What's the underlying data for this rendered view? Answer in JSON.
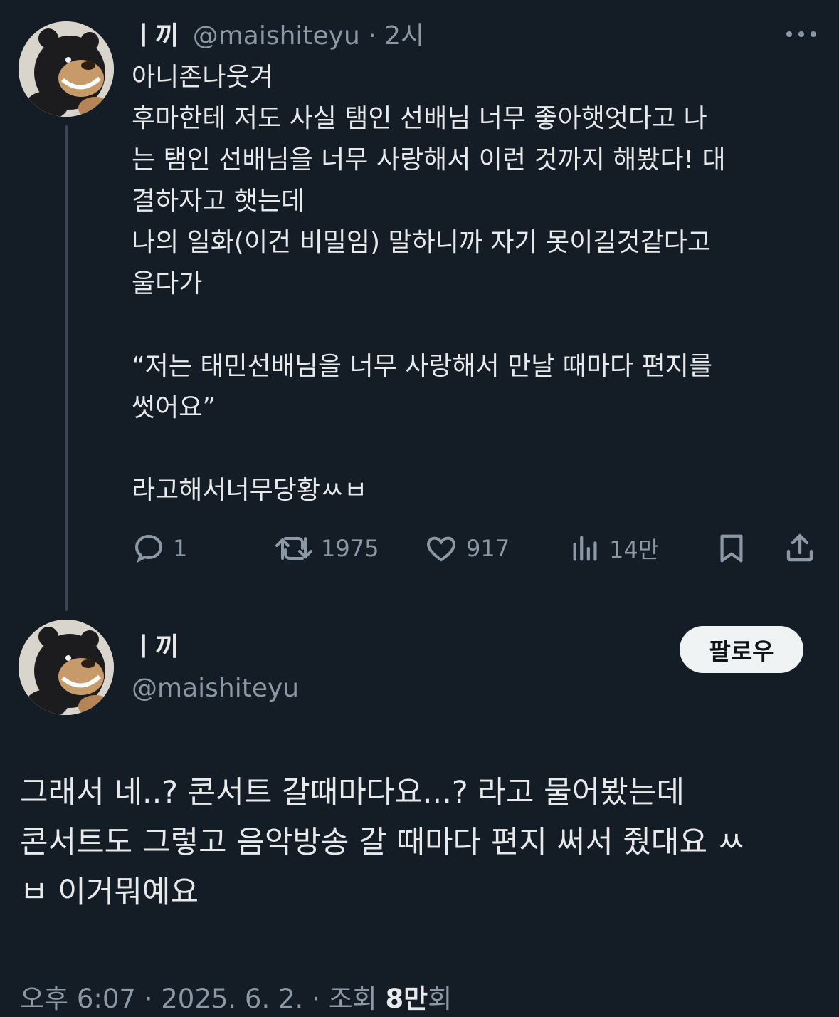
{
  "reply_tweet": {
    "display_name": "ㅣ끼",
    "handle": "@maishiteyu",
    "separator": " · ",
    "time": "2시",
    "text_lines": [
      "아니존나웃겨",
      "후마한테 저도 사실 탬인 선배님 너무 좋아햇엇다고 나",
      "는 탬인 선배님을 너무 사랑해서 이런 것까지 해봤다! 대",
      "결하자고 햇는데",
      "나의 일화(이건 비밀임) 말하니까 자기 못이길것같다고",
      "울다가",
      "",
      "“저는 태민선배님을 너무 사랑해서 만날 때마다 편지를",
      "썻어요”",
      "",
      "라고해서너무당황ㅆㅂ"
    ],
    "actions": {
      "replies": "1",
      "retweets": "1975",
      "likes": "917",
      "views": "14만"
    }
  },
  "main_tweet": {
    "display_name": "ㅣ끼",
    "handle": "@maishiteyu",
    "follow_label": "팔로우",
    "text_lines": [
      "그래서 네..? 콘서트 갈때마다요...? 라고 물어봤는데",
      "콘서트도 그렇고 음악방송 갈 때마다 편지 써서 줬대요 ㅆ",
      "ㅂ 이거뭐예요"
    ],
    "meta": {
      "time": "오후 6:07",
      "sep1": " · ",
      "date": "2025. 6. 2.",
      "sep2": " · ",
      "views_prefix": "조회 ",
      "views_count": "8만",
      "views_suffix": "회"
    }
  },
  "colors": {
    "background": "#141c26",
    "text": "#e7e9ea",
    "muted": "#8b98a5",
    "thread_line": "#3c4652",
    "follow_button_bg": "#eff3f4"
  }
}
